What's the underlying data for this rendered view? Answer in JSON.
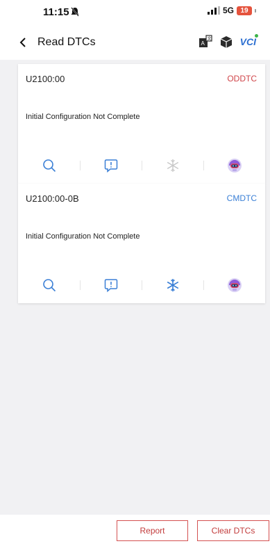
{
  "status": {
    "time": "11:15",
    "network": "5G",
    "battery": "19"
  },
  "nav": {
    "title": "Read DTCs",
    "vci_label": "VCI"
  },
  "dtcs": [
    {
      "code": "U2100:00",
      "type": "ODDTC",
      "type_color": "#d0454a",
      "description": "Initial Configuration Not Complete",
      "freeze_frame_active": false
    },
    {
      "code": "U2100:00-0B",
      "type": "CMDTC",
      "type_color": "#3a7fd6",
      "description": "Initial Configuration Not Complete",
      "freeze_frame_active": true
    }
  ],
  "card_actions": [
    "search-icon",
    "comment-icon",
    "snowflake-icon",
    "robot-icon"
  ],
  "buttons": {
    "report": "Report",
    "clear": "Clear DTCs"
  },
  "colors": {
    "accent": "#3a7fd6",
    "button_border": "#d45050",
    "content_bg": "#f1f1f3"
  }
}
